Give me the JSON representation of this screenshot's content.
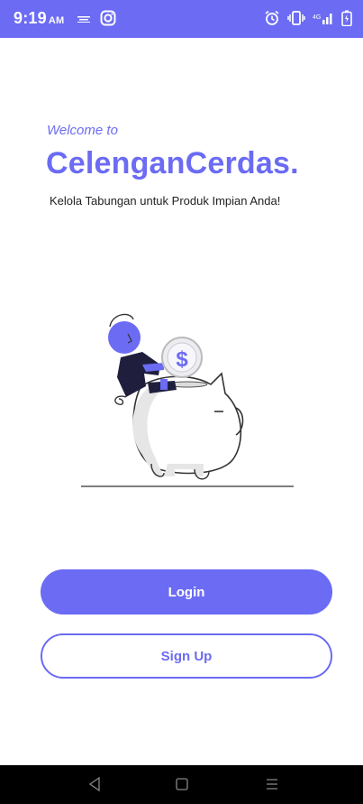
{
  "status_bar": {
    "time": "9:19",
    "ampm": "AM",
    "bg_color": "#6b6bf4",
    "icons_left": [
      "notification-icon",
      "instagram-icon"
    ],
    "icons_right": [
      "alarm-icon",
      "vibrate-icon",
      "signal-icon",
      "battery-icon"
    ]
  },
  "hero": {
    "welcome": "Welcome to",
    "brand": "CelenganCerdas.",
    "tagline": "Kelola Tabungan untuk Produk Impian Anda!",
    "illustration": "piggy-bank-illustration"
  },
  "actions": {
    "login_label": "Login",
    "signup_label": "Sign Up"
  },
  "nav_bar": {
    "buttons": [
      "back-icon",
      "home-icon",
      "menu-icon"
    ]
  },
  "colors": {
    "accent": "#6b6bf4",
    "text": "#222222",
    "background": "#ffffff"
  }
}
